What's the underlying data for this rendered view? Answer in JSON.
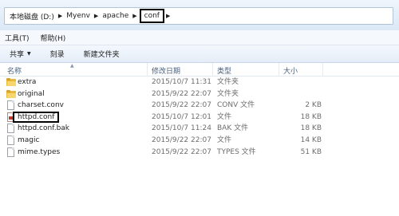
{
  "breadcrumb": {
    "items": [
      "本地磁盘 (D:)",
      "Myenv",
      "apache"
    ],
    "current": "conf"
  },
  "menu": {
    "tools": "工具(T)",
    "help": "帮助(H)"
  },
  "commands": {
    "share": "共享",
    "burn": "刻录",
    "new_folder": "新建文件夹"
  },
  "columns": {
    "name": "名称",
    "date": "修改日期",
    "type": "类型",
    "size": "大小"
  },
  "files": [
    {
      "name": "extra",
      "date": "2015/10/7 11:31",
      "type": "文件夹",
      "size": "",
      "icon": "folder-icon"
    },
    {
      "name": "original",
      "date": "2015/9/22 22:07",
      "type": "文件夹",
      "size": "",
      "icon": "folder-icon"
    },
    {
      "name": "charset.conv",
      "date": "2015/9/22 22:07",
      "type": "CONV 文件",
      "size": "2 KB",
      "icon": "file-icon"
    },
    {
      "name": "httpd.conf",
      "date": "2015/10/7 12:01",
      "type": "文件",
      "size": "18 KB",
      "icon": "config-file-icon"
    },
    {
      "name": "httpd.conf.bak",
      "date": "2015/10/7 11:24",
      "type": "BAK 文件",
      "size": "18 KB",
      "icon": "file-icon"
    },
    {
      "name": "magic",
      "date": "2015/9/22 22:07",
      "type": "文件",
      "size": "14 KB",
      "icon": "file-icon"
    },
    {
      "name": "mime.types",
      "date": "2015/9/22 22:07",
      "type": "TYPES 文件",
      "size": "51 KB",
      "icon": "file-icon"
    }
  ]
}
